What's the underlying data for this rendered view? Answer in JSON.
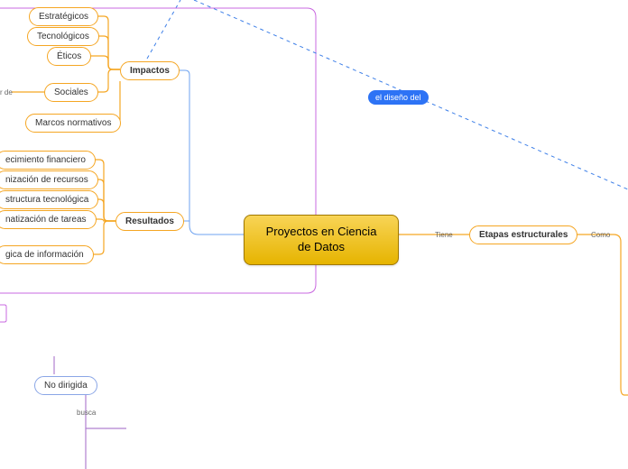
{
  "central": {
    "title": "Proyectos en Ciencia de Datos"
  },
  "left": {
    "impactos": {
      "label": "Impactos",
      "children": {
        "estrategicos": "Estratégicos",
        "tecnologicos": "Tecnológicos",
        "eticos": "Éticos",
        "sociales": "Sociales",
        "marcos": "Marcos normativos"
      },
      "side_label": "r de"
    },
    "resultados": {
      "label": "Resultados",
      "children": {
        "financiero": "ecimiento financiero",
        "recursos": "nización de recursos",
        "tecnologica": "structura tecnológica",
        "tareas": "natización de tareas",
        "informacion": "gica de información"
      }
    }
  },
  "right": {
    "etapas": {
      "label": "Etapas estructurales",
      "edge_in": "Tiene",
      "edge_out": "Como"
    }
  },
  "floating": {
    "diseno": "el diseño del"
  },
  "bottom": {
    "no_dirigida": "No dirigida",
    "busca": "busca"
  }
}
